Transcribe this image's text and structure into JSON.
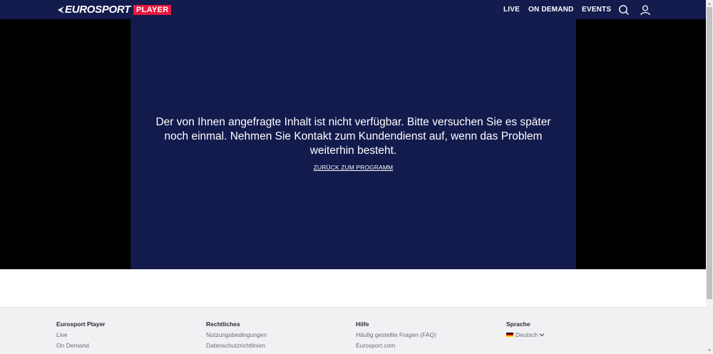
{
  "header": {
    "logo_text": "EUROSPORT",
    "logo_badge": "PLAYER",
    "nav": [
      {
        "label": "LIVE"
      },
      {
        "label": "ON DEMAND"
      },
      {
        "label": "EVENTS"
      }
    ],
    "icons": [
      "search-icon",
      "user-icon"
    ]
  },
  "player": {
    "error_message": "Der von Ihnen angefragte Inhalt ist nicht verfügbar. Bitte versuchen Sie es später noch einmal. Nehmen Sie Kontakt zum Kundendienst auf, wenn das Problem weiterhin besteht.",
    "back_link": "ZURÜCK ZUM PROGRAMM"
  },
  "footer": {
    "columns": [
      {
        "heading": "Eurosport Player",
        "links": [
          "Live",
          "On Demand"
        ]
      },
      {
        "heading": "Rechtliches",
        "links": [
          "Nutzungsbedingungen",
          "Datenschutzrichtlinien"
        ]
      },
      {
        "heading": "Hilfe",
        "links": [
          "Häufig gestellte Fragen (FAQ)",
          "Eurosport.com"
        ]
      },
      {
        "heading": "Sprache",
        "language": "Deutsch"
      }
    ]
  },
  "colors": {
    "header_bg": "#141b4d",
    "player_bg": "#131a4c",
    "badge_red": "#e8173f",
    "footer_bg": "#f1f1f4"
  }
}
